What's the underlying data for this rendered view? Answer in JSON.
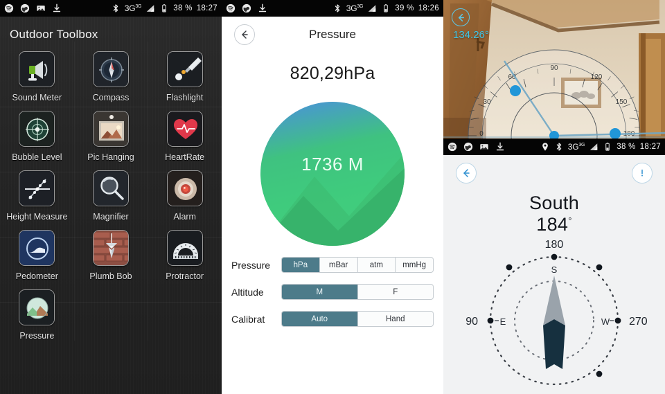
{
  "panel_launcher": {
    "statusbar": {
      "left_icons": [
        "spotify-icon",
        "browser-icon",
        "gallery-icon",
        "download-icon"
      ],
      "bluetooth": "bluetooth-icon",
      "network": "3G",
      "network_sup": "3G",
      "battery_percent": "38 %",
      "time": "18:27"
    },
    "title": "Outdoor Toolbox",
    "apps": [
      {
        "label": "Sound Meter",
        "icon": "megaphone-icon"
      },
      {
        "label": "Compass",
        "icon": "compass-icon"
      },
      {
        "label": "Flashlight",
        "icon": "flashlight-icon"
      },
      {
        "label": "Bubble Level",
        "icon": "bubble-level-icon"
      },
      {
        "label": "Pic Hanging",
        "icon": "picture-frame-icon"
      },
      {
        "label": "HeartRate",
        "icon": "heart-icon"
      },
      {
        "label": "Height Measure",
        "icon": "height-measure-icon"
      },
      {
        "label": "Magnifier",
        "icon": "magnifier-icon"
      },
      {
        "label": "Alarm",
        "icon": "alarm-icon"
      },
      {
        "label": "Pedometer",
        "icon": "pedometer-icon"
      },
      {
        "label": "Plumb Bob",
        "icon": "plumb-bob-icon"
      },
      {
        "label": "Protractor",
        "icon": "protractor-icon"
      },
      {
        "label": "Pressure",
        "icon": "pressure-icon"
      }
    ]
  },
  "panel_pressure": {
    "statusbar": {
      "left_icons": [
        "spotify-icon",
        "browser-icon",
        "download-icon"
      ],
      "bluetooth": "bluetooth-icon",
      "network": "3G",
      "network_sup": "3G",
      "battery_percent": "39 %",
      "time": "18:26"
    },
    "back_icon": "arrow-left-icon",
    "title": "Pressure",
    "reading": "820,29hPa",
    "altitude_reading": "1736 M",
    "controls": [
      {
        "label": "Pressure",
        "options": [
          "hPa",
          "mBar",
          "atm",
          "mmHg"
        ],
        "selected": "hPa"
      },
      {
        "label": "Altitude",
        "options": [
          "M",
          "F"
        ],
        "selected": "M"
      },
      {
        "label": "Calibrat",
        "options": [
          "Auto",
          "Hand"
        ],
        "selected": "Auto"
      }
    ],
    "accent_color": "#4d7b8a"
  },
  "panel_protractor": {
    "back_icon": "arrow-left-icon",
    "angle_value": "134.26°",
    "angle_color": "#3ec6e8",
    "handle_color": "#2196d8",
    "scale_labels": [
      "0",
      "30",
      "60",
      "90",
      "120",
      "150",
      "180"
    ]
  },
  "panel_compass": {
    "statusbar": {
      "left_icons": [
        "spotify-icon",
        "browser-icon",
        "gallery-icon",
        "download-icon"
      ],
      "location": "location-pin-icon",
      "bluetooth": "bluetooth-icon",
      "network": "3G",
      "network_sup": "3G",
      "battery_percent": "38 %",
      "time": "18:27"
    },
    "back_icon": "arrow-left-icon",
    "info_icon": "exclamation-circle-icon",
    "direction": "South",
    "degrees": "184",
    "degree_symbol": "°",
    "dial_labels": {
      "top": "180",
      "top_cardinal": "S",
      "left": "90",
      "left_cardinal": "E",
      "right": "270",
      "right_cardinal": "W"
    },
    "accent_color": "#2d8fd0"
  }
}
